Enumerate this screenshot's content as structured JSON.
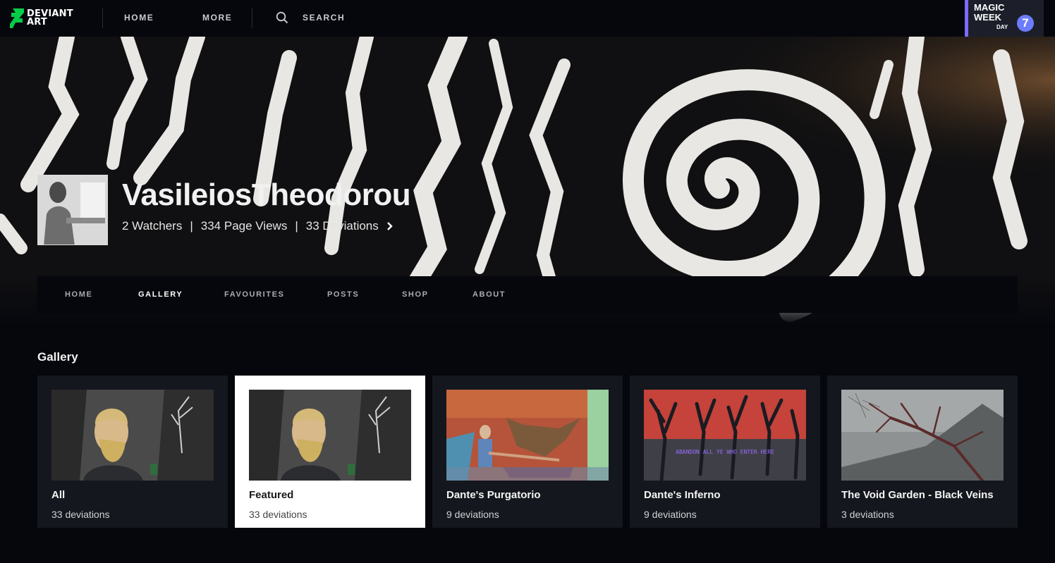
{
  "topbar": {
    "logo_text_line1": "DEVIANT",
    "logo_text_line2": "ART",
    "nav_home": "HOME",
    "nav_more": "MORE",
    "search_label": "SEARCH",
    "search_icon": "search-icon",
    "magic_week": {
      "line1": "MAGIC",
      "line2": "WEEK",
      "day_label": "DAY",
      "day_number": "7"
    }
  },
  "profile": {
    "username": "VasileiosTheodorou",
    "watchers": "2 Watchers",
    "page_views": "334 Page Views",
    "deviations": "33 Deviations",
    "separator": "|",
    "more_icon": "chevron-right-icon",
    "nav": [
      {
        "label": "HOME",
        "active": false
      },
      {
        "label": "GALLERY",
        "active": true
      },
      {
        "label": "FAVOURITES",
        "active": false
      },
      {
        "label": "POSTS",
        "active": false
      },
      {
        "label": "SHOP",
        "active": false
      },
      {
        "label": "ABOUT",
        "active": false
      }
    ]
  },
  "gallery": {
    "title": "Gallery",
    "folders": [
      {
        "title": "All",
        "count": "33 deviations",
        "selected": false
      },
      {
        "title": "Featured",
        "count": "33 deviations",
        "selected": true
      },
      {
        "title": "Dante's Purgatorio",
        "count": "9 deviations",
        "selected": false
      },
      {
        "title": "Dante's Inferno",
        "count": "9 deviations",
        "selected": false,
        "thumb_caption": "ABANDON ALL YE WHO ENTER HERE"
      },
      {
        "title": "The Void Garden - Black Veins",
        "count": "3 deviations",
        "selected": false
      }
    ]
  },
  "colors": {
    "background": "#06070d",
    "card": "#14171d",
    "magic_accent": "#7b6bff",
    "logo_green": "#05cc47"
  }
}
